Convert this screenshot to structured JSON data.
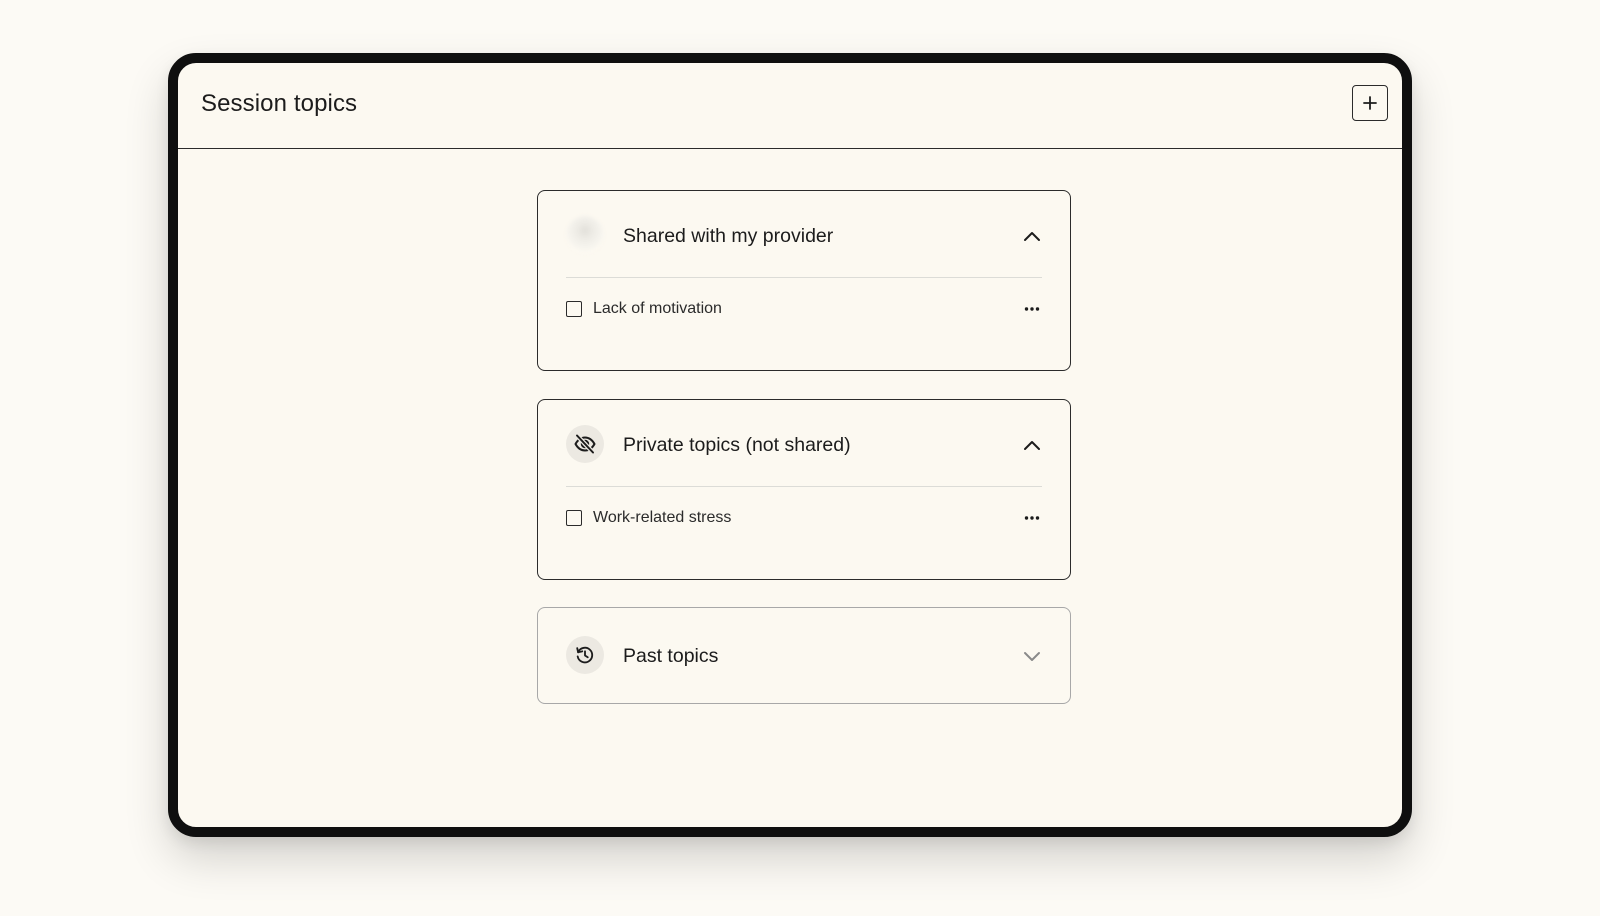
{
  "header": {
    "title": "Session topics",
    "add_icon": "plus-icon"
  },
  "sections": [
    {
      "title": "Shared with my provider",
      "icon": "provider-avatar",
      "expanded": true,
      "items": [
        {
          "label": "Lack of motivation",
          "checked": false
        }
      ]
    },
    {
      "title": "Private topics (not shared)",
      "icon": "eye-off-icon",
      "expanded": true,
      "items": [
        {
          "label": "Work-related stress",
          "checked": false
        }
      ]
    },
    {
      "title": "Past topics",
      "icon": "history-icon",
      "expanded": false,
      "items": []
    }
  ],
  "annotation": {
    "type": "hand-drawn-arrow",
    "points_to": "eye-off-icon"
  },
  "colors": {
    "page_background": "#fcfaf5",
    "panel_background": "#fcf9f1",
    "device_frame": "#0f0f0f",
    "border": "#2b2b2b",
    "muted_border": "#a8a8a8",
    "icon_circle": "#ece9e2"
  }
}
